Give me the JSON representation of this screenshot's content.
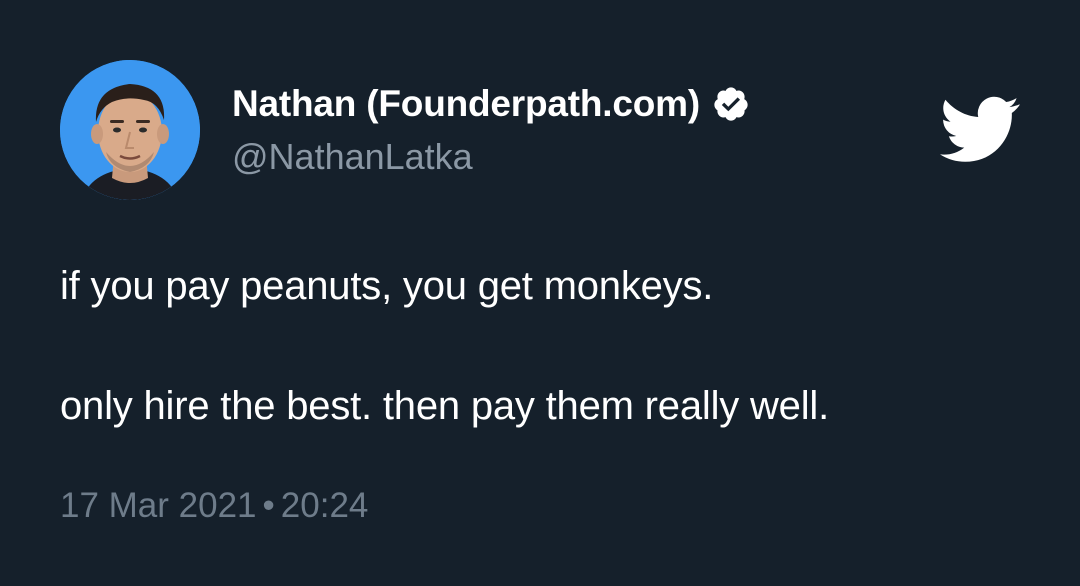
{
  "author": {
    "display_name": "Nathan (Founderpath.com)",
    "handle": "@NathanLatka",
    "verified": true,
    "avatar_icon": "profile-photo"
  },
  "tweet": {
    "lines": [
      "if you pay peanuts, you get monkeys.",
      "only hire the best. then pay them really well."
    ]
  },
  "meta": {
    "date": "17 Mar 2021",
    "separator": "•",
    "time": "20:24"
  },
  "icons": {
    "verified": "verified-badge-icon",
    "brand": "twitter-bird-icon"
  },
  "colors": {
    "background": "#15202b",
    "text_primary": "#ffffff",
    "text_secondary": "#8b98a5",
    "avatar_bg": "#3b97f0"
  }
}
